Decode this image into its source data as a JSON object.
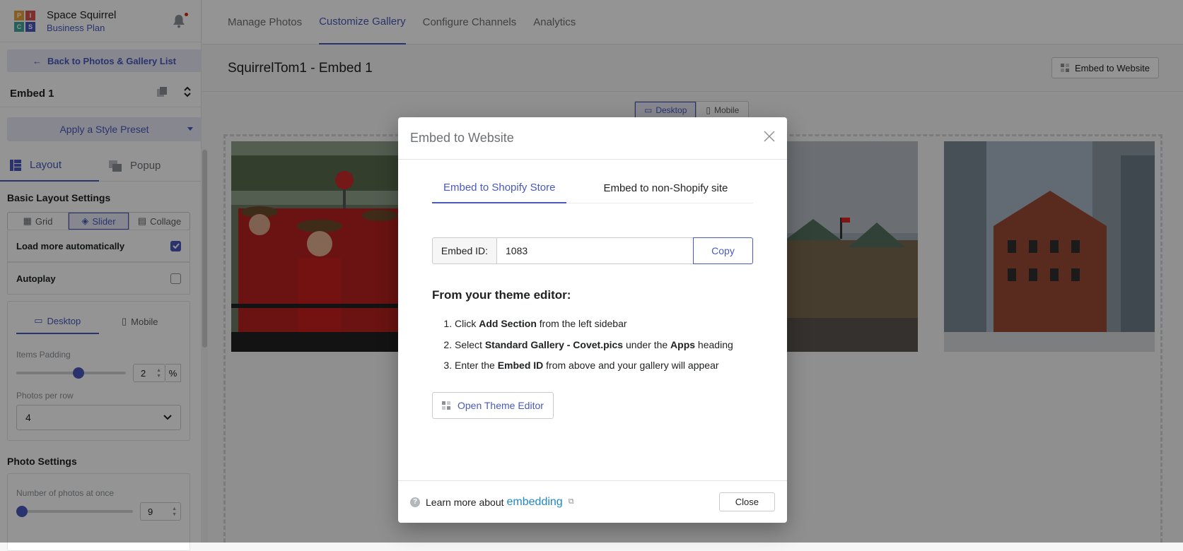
{
  "brand": {
    "name": "Space Squirrel",
    "plan": "Business Plan",
    "logo_letters": [
      "P",
      "I",
      "C",
      "S"
    ]
  },
  "sidebar": {
    "back_label": "Back to Photos & Gallery List",
    "embed_name": "Embed 1",
    "preset_label": "Apply a Style Preset",
    "tabs": {
      "layout": "Layout",
      "popup": "Popup"
    },
    "basic_layout_title": "Basic Layout Settings",
    "layout_modes": {
      "grid": "Grid",
      "slider": "Slider",
      "collage": "Collage"
    },
    "load_more_label": "Load more automatically",
    "autoplay_label": "Autoplay",
    "device_tabs": {
      "desktop": "Desktop",
      "mobile": "Mobile"
    },
    "items_padding_label": "Items Padding",
    "items_padding_value": "2",
    "items_padding_fraction": 0.57,
    "padding_unit": "%",
    "photos_per_row_label": "Photos per row",
    "photos_per_row_value": "4",
    "photo_settings_title": "Photo Settings",
    "photos_at_once_label": "Number of photos at once",
    "photos_at_once_value": "9",
    "photos_at_once_fraction": 0.0
  },
  "nav": {
    "tabs": [
      "Manage Photos",
      "Customize Gallery",
      "Configure Channels",
      "Analytics"
    ],
    "active": 1
  },
  "page": {
    "title": "SquirrelTom1 - Embed 1",
    "embed_button": "Embed to Website",
    "view_desktop": "Desktop",
    "view_mobile": "Mobile"
  },
  "modal": {
    "title": "Embed to Website",
    "tabs": [
      "Embed to Shopify Store",
      "Embed to non-Shopify site"
    ],
    "embed_id_label": "Embed ID:",
    "embed_id_value": "1083",
    "copy_label": "Copy",
    "theme_heading": "From your theme editor:",
    "steps": [
      {
        "before": "Click ",
        "bold1": "Add Section",
        "after": " from the left sidebar",
        "bold2": "",
        "tail": ""
      },
      {
        "before": "Select ",
        "bold1": "Standard Gallery - Covet.pics",
        "after": " under the ",
        "bold2": "Apps",
        "tail": " heading"
      },
      {
        "before": "Enter the ",
        "bold1": "Embed ID",
        "after": " from above and your gallery will appear",
        "bold2": "",
        "tail": ""
      }
    ],
    "open_editor_label": "Open Theme Editor",
    "footer_text": "Learn more about",
    "footer_link": "embedding",
    "close_label": "Close"
  },
  "colors": {
    "accent": "#4959bd",
    "link": "#1e88c6"
  }
}
